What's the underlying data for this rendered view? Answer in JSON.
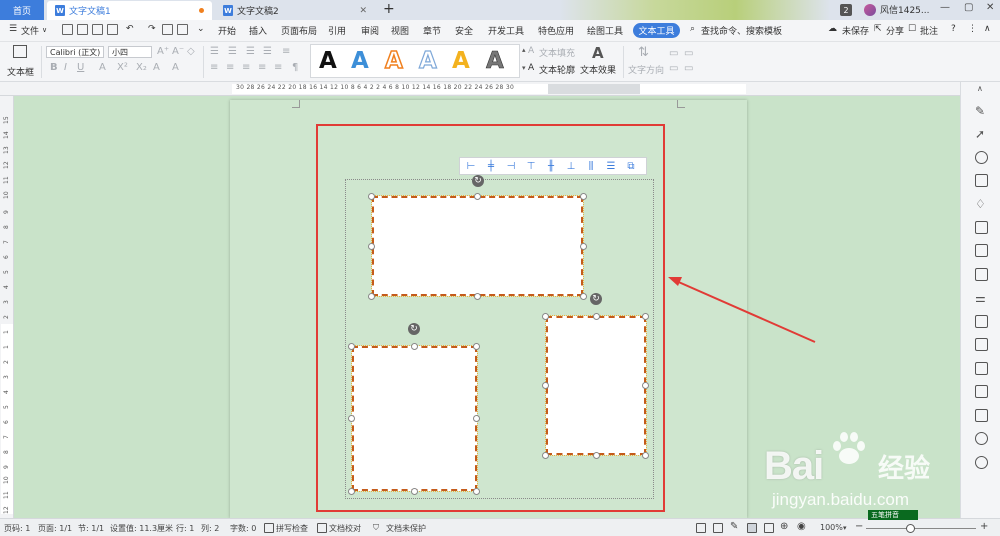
{
  "tabbar": {
    "home": "首页",
    "tabs": [
      {
        "label": "文字文稿1",
        "icon": "W",
        "active": true
      },
      {
        "label": "文字文稿2",
        "icon": "W",
        "active": false
      }
    ],
    "new_tab": "+",
    "badge": "2",
    "user": "风信1425...",
    "win": {
      "min": "—",
      "restore": "▢",
      "close": "✕"
    }
  },
  "menubar": {
    "file": "文件",
    "file_caret": "∨",
    "tabs": [
      "开始",
      "插入",
      "页面布局",
      "引用",
      "审阅",
      "视图",
      "章节",
      "安全",
      "开发工具",
      "特色应用",
      "绘图工具",
      "文本工具"
    ],
    "active_tab": "文本工具",
    "search": "查找命令、搜索模板",
    "right": {
      "unsaved": "未保存",
      "share": "分享",
      "comment": "批注",
      "help": "?"
    }
  },
  "ribbon": {
    "textbox_label": "文本框",
    "font_name": "Calibri (正文)",
    "font_size": "小四",
    "fill": "文本填充",
    "outline": "文本轮廓",
    "effect": "文本效果",
    "direction": "文字方向",
    "style_colors": [
      "#111111",
      "#3d8fd8",
      "#f0801f",
      "#7fa8d8",
      "#f3b21f",
      "#777777"
    ]
  },
  "ruler": {
    "ticks": "30 28 26 24 22 20 18 16 14 12 10  8  6  4  2     2  4  6  8 10 12 14 16 18 20 22 24 26 28 30",
    "v_ticks": [
      "15",
      "14",
      "13",
      "12",
      "11",
      "10",
      "9",
      "8",
      "7",
      "6",
      "5",
      "4",
      "3",
      "2",
      "1",
      "1",
      "2",
      "3",
      "4",
      "5",
      "6",
      "7",
      "8",
      "9",
      "10",
      "11",
      "12"
    ]
  },
  "statusbar": {
    "page_no": "页码: 1",
    "pages": "页面: 1/1",
    "section": "节: 1/1",
    "setting": "设置值: 11.3厘米",
    "row": "行: 1",
    "col": "列: 2",
    "words": "字数: 0",
    "spell": "拼写检查",
    "proof": "文档校对",
    "protect": "文档未保护",
    "zoom": "100%",
    "ime": "五笔拼音"
  },
  "watermark": {
    "bai": "Bai",
    "du_paw": "du",
    "cn": "经验",
    "url": "jingyan.baidu.com"
  }
}
